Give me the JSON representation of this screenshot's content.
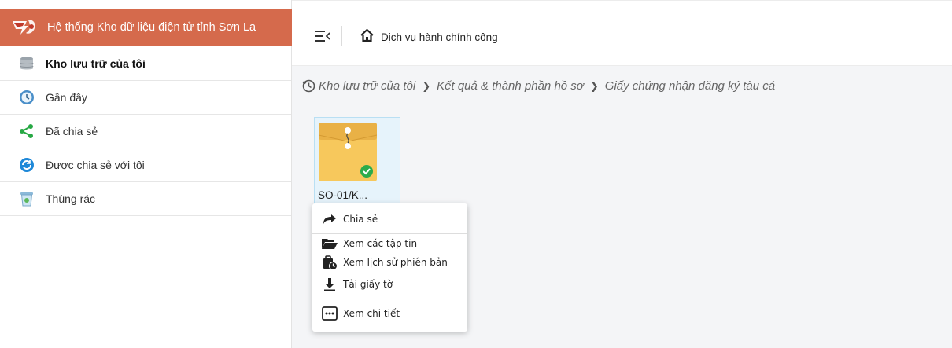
{
  "sidebar": {
    "brand_title": "Hệ thống Kho dữ liệu điện tử tỉnh Sơn La",
    "items": [
      {
        "label": "Kho lưu trữ của tôi",
        "icon": "database-icon",
        "active": true
      },
      {
        "label": "Gần đây",
        "icon": "clock-icon"
      },
      {
        "label": "Đã chia sẻ",
        "icon": "share-icon"
      },
      {
        "label": "Được chia sẻ với tôi",
        "icon": "shared-with-me-icon"
      },
      {
        "label": "Thùng rác",
        "icon": "trash-icon"
      }
    ]
  },
  "topbar": {
    "home_label": "Dịch vụ hành chính công"
  },
  "breadcrumb": [
    "Kho lưu trữ của tôi",
    "Kết quả & thành phần hồ sơ",
    "Giấy chứng nhận đăng ký tàu cá"
  ],
  "file": {
    "name": "SO-01/K...",
    "status": "verified"
  },
  "context_menu": {
    "items": [
      {
        "label": "Chia sẻ",
        "icon": "share-arrow-icon"
      },
      {
        "label": "Xem các tập tin",
        "icon": "folder-open-icon"
      },
      {
        "label": "Xem lịch sử phiên bản",
        "icon": "version-history-icon"
      },
      {
        "label": "Tải giấy tờ",
        "icon": "download-icon"
      },
      {
        "label": "Xem chi tiết",
        "icon": "details-icon"
      }
    ]
  },
  "colors": {
    "brand": "#d56a4c",
    "selected_tile": "#e6f3fb",
    "folder": "#f7c85c",
    "check": "#2cab4b"
  }
}
